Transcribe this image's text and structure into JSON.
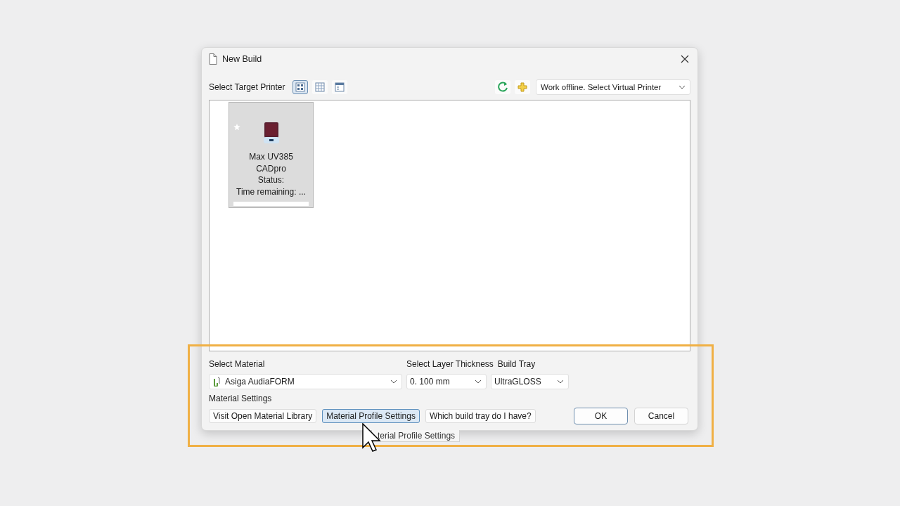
{
  "window": {
    "title": "New Build"
  },
  "printer_section": {
    "label": "Select Target Printer",
    "view_modes": [
      {
        "kind": "large-icons",
        "selected": true
      },
      {
        "kind": "table",
        "selected": false
      },
      {
        "kind": "details",
        "selected": false
      }
    ],
    "printer_dropdown": {
      "value": "Work offline. Select Virtual Printer"
    }
  },
  "printers": [
    {
      "name": "Max UV385",
      "model": "CADpro",
      "status": "Status:",
      "time": "Time remaining: ...",
      "selected": true,
      "favorite": true
    }
  ],
  "material": {
    "label": "Select Material",
    "value": "Asiga AudiaFORM"
  },
  "layer_thickness": {
    "label": "Select Layer Thickness",
    "value": "0. 100 mm"
  },
  "build_tray": {
    "label": "Build Tray",
    "value": "UltraGLOSS"
  },
  "material_settings": {
    "label": "Material Settings",
    "buttons": [
      {
        "label": "Visit Open Material Library",
        "focused": false
      },
      {
        "label": "Material Profile Settings",
        "focused": true
      },
      {
        "label": "Which build tray do I have?",
        "focused": false
      }
    ]
  },
  "buttons": [
    {
      "label": "OK",
      "default": true
    },
    {
      "label": "Cancel",
      "default": false
    }
  ],
  "tooltip": {
    "text": "terial Profile Settings"
  }
}
